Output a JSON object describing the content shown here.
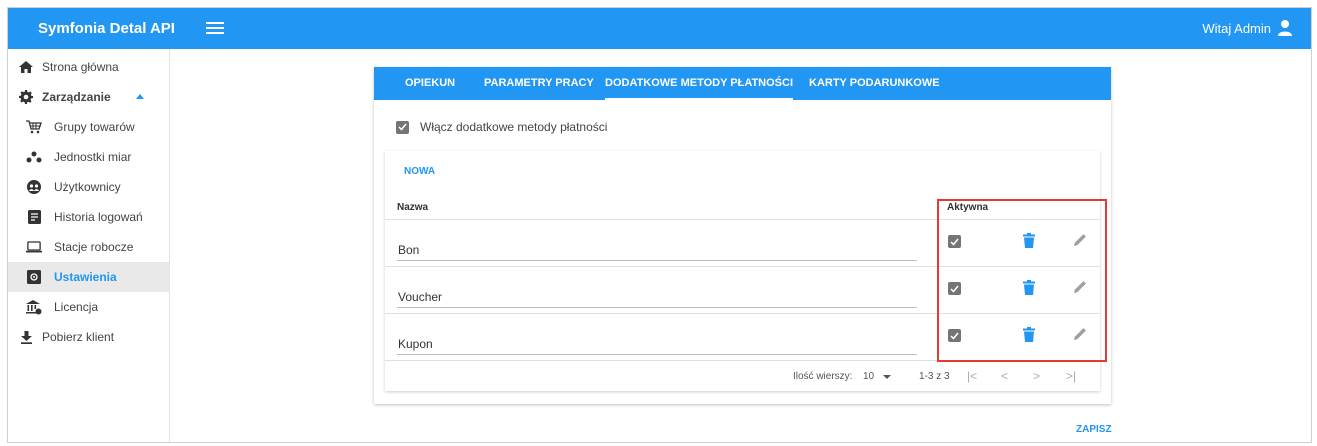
{
  "header": {
    "app_title": "Symfonia Detal API",
    "user_greeting": "Witaj Admin"
  },
  "sidebar": {
    "items": [
      {
        "label": "Strona główna"
      },
      {
        "label": "Zarządzanie"
      },
      {
        "label": "Grupy towarów"
      },
      {
        "label": "Jednostki miar"
      },
      {
        "label": "Użytkownicy"
      },
      {
        "label": "Historia logowań"
      },
      {
        "label": "Stacje robocze"
      },
      {
        "label": "Ustawienia"
      },
      {
        "label": "Licencja"
      },
      {
        "label": "Pobierz klient"
      }
    ]
  },
  "tabs": [
    {
      "label": "OPIEKUN"
    },
    {
      "label": "PARAMETRY PRACY"
    },
    {
      "label": "DODATKOWE METODY PŁATNOŚCI"
    },
    {
      "label": "KARTY PODARUNKOWE"
    }
  ],
  "settings": {
    "enable_label": "Włącz dodatkowe metody płatności",
    "enable_checked": true
  },
  "table": {
    "new_button": "NOWA",
    "columns": [
      "Nazwa",
      "Aktywna"
    ],
    "rows": [
      {
        "name": "Bon",
        "active": true
      },
      {
        "name": "Voucher",
        "active": true
      },
      {
        "name": "Kupon",
        "active": true
      }
    ],
    "pagination": {
      "rows_per_page_label": "Ilość wierszy:",
      "rows_per_page": "10",
      "range": "1-3 z 3",
      "first": "|<",
      "prev": "<",
      "next": ">",
      "last": ">|"
    }
  },
  "save_button": "ZAPISZ",
  "colors": {
    "accent": "#2196f3",
    "highlight": "#e53935"
  }
}
